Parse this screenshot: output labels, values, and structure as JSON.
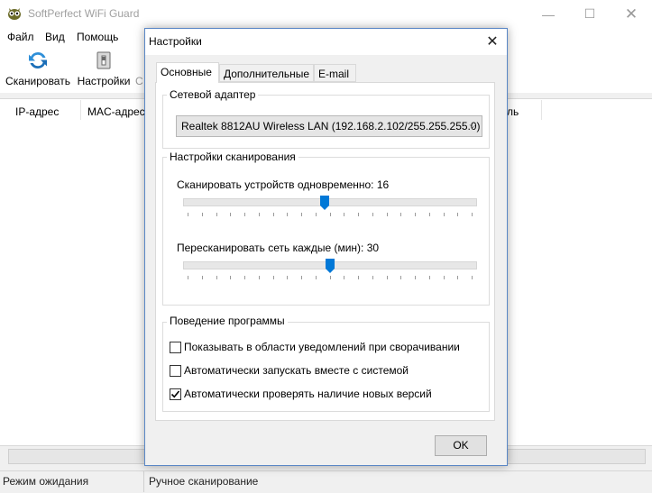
{
  "app": {
    "title": "SoftPerfect WiFi Guard"
  },
  "menu": [
    "Файл",
    "Вид",
    "Помощь"
  ],
  "toolbar": {
    "scan_label": "Сканировать",
    "settings_label": "Настройки",
    "partial_label": "С"
  },
  "list": {
    "columns": [
      "IP-адрес",
      "MAC-адрес",
      "ль"
    ]
  },
  "status": {
    "left": "Режим ожидания",
    "right": "Ручное сканирование"
  },
  "dialog": {
    "title": "Настройки",
    "tabs": [
      "Основные",
      "Дополнительные",
      "E-mail"
    ],
    "active_tab": "Основные",
    "adapter_group": "Сетевой адаптер",
    "adapter_value": "Realtek 8812AU Wireless LAN (192.168.2.102/255.255.255.0)",
    "scan_group": "Настройки сканирования",
    "concurrent_label": "Сканировать устройств одновременно: 16",
    "concurrent_level": 0.48,
    "rescan_label": "Пересканировать сеть каждые (мин): 30",
    "rescan_level": 0.5,
    "behavior_group": "Поведение программы",
    "checkboxes": [
      {
        "label": "Показывать в области уведомлений при сворачивании",
        "checked": false
      },
      {
        "label": "Автоматически запускать вместе с системой",
        "checked": false
      },
      {
        "label": "Автоматически проверять наличие новых версий",
        "checked": true
      }
    ],
    "ok_label": "OK"
  },
  "colors": {
    "accent": "#0078d7",
    "scan_icon": "#2f8fd8"
  }
}
